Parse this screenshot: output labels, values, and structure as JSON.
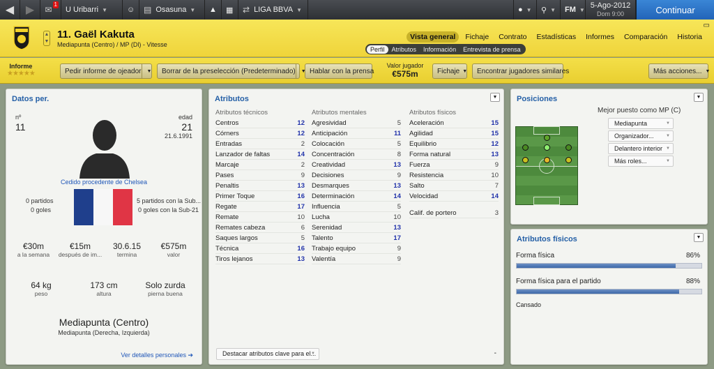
{
  "topbar": {
    "club": "U Uribarri",
    "badge": "1",
    "team": "Osasuna",
    "competition": "LIGA BBVA",
    "fm": "FM",
    "date": "5-Ago-2012",
    "day_time": "Dom 9:00",
    "continue": "Continuar"
  },
  "header": {
    "name": "11. Gaël Kakuta",
    "subtitle": "Mediapunta (Centro) / MP (Dl) - Vitesse",
    "crest_text": "VITESSE",
    "tabs": [
      "Vista general",
      "Fichaje",
      "Contrato",
      "Estadísticas",
      "Informes",
      "Comparación",
      "Historia"
    ],
    "subtabs": [
      "Perfil",
      "Atributos",
      "Información",
      "Entrevista de prensa"
    ]
  },
  "actionbar": {
    "informe_label": "Informe",
    "stars": "★★★★★",
    "buttons": {
      "scout": "Pedir informe de ojeador",
      "shortlist": "Borrar de la preselección (Predeterminado)",
      "press": "Hablar con la prensa",
      "fichaje": "Fichaje",
      "similar": "Encontrar jugadores similares",
      "more": "Más acciones..."
    },
    "valor_label": "Valor jugador",
    "valor": "€575m"
  },
  "personal": {
    "title": "Datos per.",
    "num_label": "nº",
    "num": "11",
    "age_label": "edad",
    "age": "21",
    "dob": "21.6.1991",
    "loan": "Cedido procedente de Chelsea",
    "partidos": "0 partidos",
    "goles": "0 goles",
    "sub21_partidos": "5 partidos con la Sub...",
    "sub21_goles": "0 goles con la Sub-21",
    "stats": [
      {
        "v": "€30m",
        "l": "a la semana"
      },
      {
        "v": "€15m",
        "l": "después de im..."
      },
      {
        "v": "30.6.15",
        "l": "termina"
      },
      {
        "v": "€575m",
        "l": "valor"
      }
    ],
    "body": [
      {
        "v": "64 kg",
        "l": "peso"
      },
      {
        "v": "173 cm",
        "l": "altura"
      },
      {
        "v": "Solo zurda",
        "l": "pierna buena"
      }
    ],
    "position": "Mediapunta (Centro)",
    "position_sub": "Mediapunta (Derecha, Izquierda)",
    "more_link": "Ver detalles personales ➔"
  },
  "attributes": {
    "title": "Atributos",
    "tech_h": "Atributos técnicos",
    "ment_h": "Atributos mentales",
    "phys_h": "Atributos físicos",
    "technical": [
      [
        "Centros",
        "12"
      ],
      [
        "Córners",
        "12"
      ],
      [
        "Entradas",
        "2"
      ],
      [
        "Lanzador de faltas",
        "14"
      ],
      [
        "Marcaje",
        "2"
      ],
      [
        "Pases",
        "9"
      ],
      [
        "Penaltis",
        "13"
      ],
      [
        "Primer Toque",
        "16"
      ],
      [
        "Regate",
        "17"
      ],
      [
        "Remate",
        "10"
      ],
      [
        "Remates cabeza",
        "6"
      ],
      [
        "Saques largos",
        "5"
      ],
      [
        "Técnica",
        "16"
      ],
      [
        "Tiros lejanos",
        "13"
      ]
    ],
    "mental": [
      [
        "Agresividad",
        "5"
      ],
      [
        "Anticipación",
        "11"
      ],
      [
        "Colocación",
        "5"
      ],
      [
        "Concentración",
        "8"
      ],
      [
        "Creatividad",
        "13"
      ],
      [
        "Decisiones",
        "9"
      ],
      [
        "Desmarques",
        "13"
      ],
      [
        "Determinación",
        "14"
      ],
      [
        "Influencia",
        "5"
      ],
      [
        "Lucha",
        "10"
      ],
      [
        "Serenidad",
        "13"
      ],
      [
        "Talento",
        "17"
      ],
      [
        "Trabajo equipo",
        "9"
      ],
      [
        "Valentía",
        "9"
      ]
    ],
    "physical": [
      [
        "Aceleración",
        "15"
      ],
      [
        "Agilidad",
        "15"
      ],
      [
        "Equilibrio",
        "12"
      ],
      [
        "Forma natural",
        "13"
      ],
      [
        "Fuerza",
        "9"
      ],
      [
        "Resistencia",
        "10"
      ],
      [
        "Salto",
        "7"
      ],
      [
        "Velocidad",
        "14"
      ]
    ],
    "gk": [
      [
        "Calif. de portero",
        "3"
      ]
    ],
    "highlight": "Destacar atributos clave para el...",
    "dash": "-"
  },
  "positions": {
    "title": "Posiciones",
    "best": "Mejor puesto como MP (C)",
    "roles": [
      "Mediapunta",
      "Organizador...",
      "Delantero interior",
      "Más roles..."
    ]
  },
  "fitness": {
    "title": "Atributos físicos",
    "items": [
      {
        "label": "Forma física",
        "value": "86%",
        "frac": 0.86
      },
      {
        "label": "Forma física para el partido",
        "value": "88%",
        "frac": 0.88
      }
    ],
    "status": "Cansado"
  }
}
